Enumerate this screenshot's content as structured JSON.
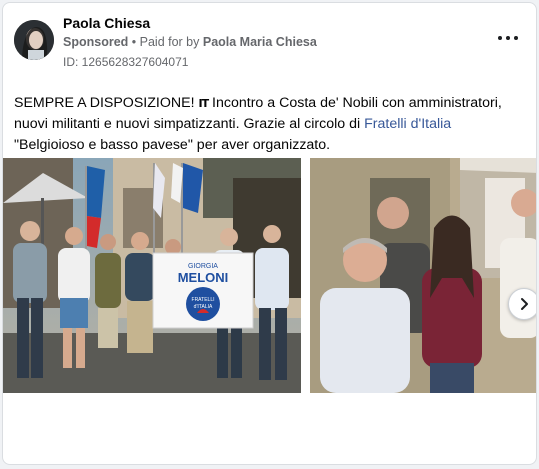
{
  "post": {
    "author": "Paola Chiesa",
    "sponsored_label": "Sponsored",
    "separator": " • ",
    "paid_for_prefix": "Paid for by ",
    "paid_for_name": "Paola Maria Chiesa",
    "ad_id": "ID: 1265628327604071",
    "text_part1": "SEMPRE A DISPOSIZIONE! ",
    "text_icon": "IT",
    "text_part2": " Incontro a Costa de' Nobili con amministratori, nuovi militanti e nuovi simpatizzanti. Grazie al circolo di ",
    "text_link": "Fratelli d'Italia",
    "text_part3": " \"Belgioioso e basso pavese\" per aver organizzato."
  },
  "photos": [
    {
      "banner_line1": "GIORGIA",
      "banner_line2": "MELONI",
      "logo_line1": "FRATELLI",
      "logo_line2": "d'ITALIA"
    },
    {}
  ],
  "icons": {
    "more": "more-options-icon",
    "next": "chevron-right-icon",
    "avatar": "profile-photo"
  },
  "colors": {
    "link": "#385898",
    "secondary_text": "#65676b",
    "card_border": "#dadde1"
  }
}
